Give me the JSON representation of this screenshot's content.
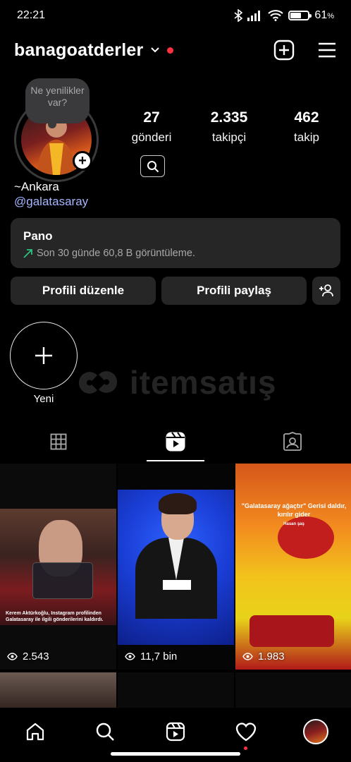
{
  "status_bar": {
    "time": "22:21",
    "battery": "61",
    "battery_unit": "%",
    "battery_level": 0.61
  },
  "header": {
    "username": "banagoatderler"
  },
  "profile": {
    "note": "Ne yenilikler var?",
    "stats": [
      {
        "value": "27",
        "label": "gönderi"
      },
      {
        "value": "2.335",
        "label": "takipçi"
      },
      {
        "value": "462",
        "label": "takip"
      }
    ],
    "bio_name": "~Ankara",
    "bio_mention": "@galatasaray"
  },
  "dashboard": {
    "title": "Pano",
    "subtitle": "Son 30 günde 60,8 B görüntüleme."
  },
  "buttons": {
    "edit": "Profili düzenle",
    "share": "Profili paylaş"
  },
  "highlight": {
    "label": "Yeni"
  },
  "watermark": {
    "text": "itemsatış"
  },
  "posts": [
    {
      "views": "2.543",
      "caption": "Kerem Aktürkoğlu, Instagram profilinden Galatasaray ile ilgili gönderilerini kaldırdı."
    },
    {
      "views": "11,7 bin"
    },
    {
      "views": "1.983",
      "caption": "\"Galatasaray ağaçtır\" Gerisi daldır, kırılır gider",
      "caption_author": "Hasan şaş"
    }
  ],
  "colors": {
    "accent_red": "#ff3040",
    "mention": "#a5b7ff",
    "surface": "#262626"
  }
}
